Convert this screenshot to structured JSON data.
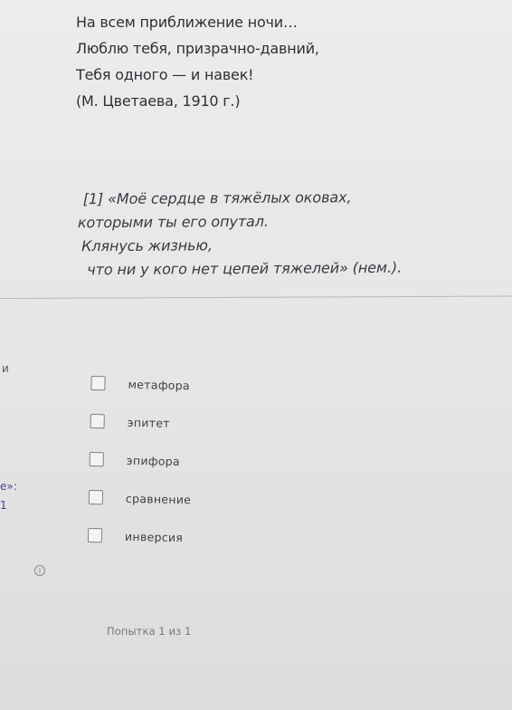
{
  "poem": {
    "lines": [
      "На всем приближение ночи…",
      "Люблю тебя, призрачно-давний,",
      "Тебя одного — и навек!",
      "(М. Цветаева, 1910 г.)"
    ]
  },
  "quote": {
    "lines": [
      "[1] «Моё сердце в тяжёлых оковах,",
      "которыми ты его опутал.",
      "Клянусь жизнью,",
      "что ни у кого нет цепей тяжелей» (нем.)."
    ]
  },
  "left_cut": {
    "text_1": "и",
    "text_2": "е»:",
    "text_3": "1"
  },
  "options": [
    {
      "label": "метафора",
      "checked": false
    },
    {
      "label": "эпитет",
      "checked": false
    },
    {
      "label": "эпифора",
      "checked": false
    },
    {
      "label": "сравнение",
      "checked": false
    },
    {
      "label": "инверсия",
      "checked": false
    }
  ],
  "info": {
    "icon": "info-icon",
    "glyph": "i"
  },
  "attempt": {
    "text": "Попытка 1 из 1"
  }
}
